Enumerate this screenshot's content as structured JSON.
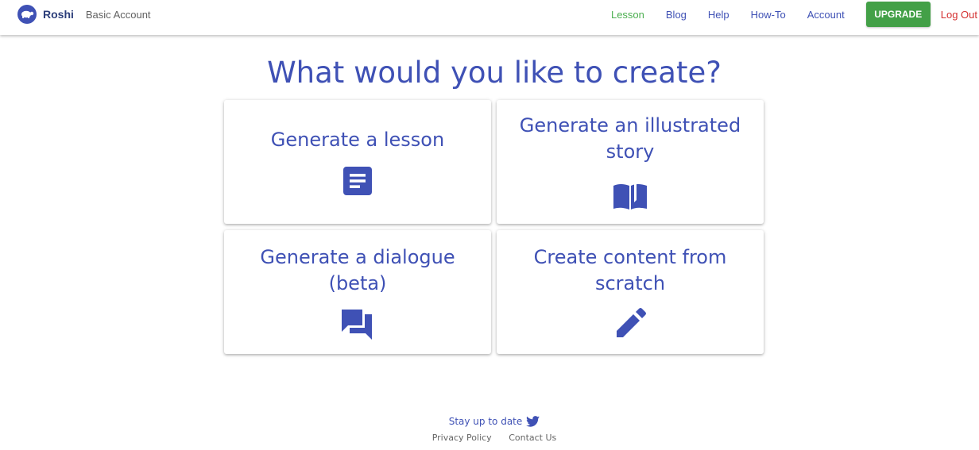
{
  "colors": {
    "primary": "#3f51b5",
    "active_link": "#4caf50",
    "upgrade_bg": "#43a047",
    "logout": "#d32f2f"
  },
  "header": {
    "brand": "Roshi",
    "account_type": "Basic Account",
    "nav": {
      "lesson": "Lesson",
      "blog": "Blog",
      "help": "Help",
      "howto": "How-To",
      "account": "Account"
    },
    "active_nav": "Lesson",
    "upgrade_label": "UPGRADE",
    "logout_label": "Log Out"
  },
  "main": {
    "title": "What would you like to create?",
    "cards": [
      {
        "title": "Generate a lesson",
        "icon": "lesson-document-icon"
      },
      {
        "title": "Generate an illustrated\nstory",
        "icon": "open-book-icon"
      },
      {
        "title": "Generate a dialogue\n(beta)",
        "icon": "chat-bubbles-icon"
      },
      {
        "title": "Create content from\nscratch",
        "icon": "pencil-icon"
      }
    ]
  },
  "footer": {
    "stay_label": "Stay up to date",
    "stay_icon": "twitter-bird-icon",
    "privacy": "Privacy Policy",
    "contact": "Contact Us"
  }
}
